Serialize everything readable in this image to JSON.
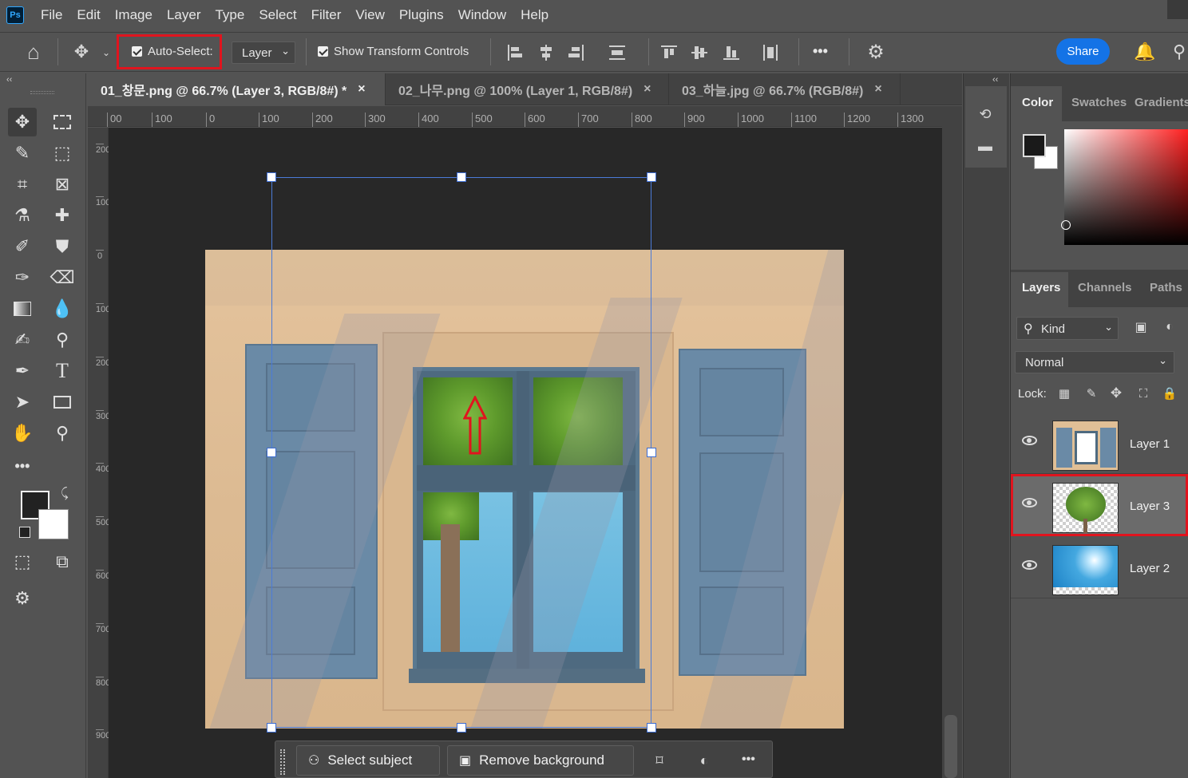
{
  "app": {
    "logo": "Ps"
  },
  "menu": [
    "File",
    "Edit",
    "Image",
    "Layer",
    "Type",
    "Select",
    "Filter",
    "View",
    "Plugins",
    "Window",
    "Help"
  ],
  "options": {
    "auto_select_label": "Auto-Select:",
    "auto_select_checked": true,
    "target_value": "Layer",
    "show_transform_label": "Show Transform Controls",
    "show_transform_checked": true,
    "more": "•••",
    "share_label": "Share"
  },
  "tabs": [
    {
      "label": "01_창문.png @ 66.7% (Layer 3, RGB/8#) *",
      "active": true
    },
    {
      "label": "02_나무.png @ 100% (Layer 1, RGB/8#)",
      "active": false
    },
    {
      "label": "03_하늘.jpg @ 66.7% (RGB/8#)",
      "active": false
    }
  ],
  "tab_close": "×",
  "ruler_top": [
    "00",
    "100",
    "0",
    "100",
    "200",
    "300",
    "400",
    "500",
    "600",
    "700",
    "800",
    "900",
    "1000",
    "1100",
    "1200",
    "1300"
  ],
  "ruler_left": [
    "200",
    "100",
    "0",
    "100",
    "200",
    "300",
    "400",
    "500",
    "600",
    "700",
    "800",
    "900"
  ],
  "context_bar": {
    "select_subject": "Select subject",
    "remove_background": "Remove background",
    "more": "•••"
  },
  "panels": {
    "color_tabs": [
      "Color",
      "Swatches",
      "Gradients"
    ],
    "layer_tabs": [
      "Layers",
      "Channels",
      "Paths"
    ],
    "kind_label": "Kind",
    "blend_mode": "Normal",
    "lock_label": "Lock:",
    "layers": [
      {
        "name": "Layer 1",
        "selected": false,
        "visible": true,
        "thumb": "window"
      },
      {
        "name": "Layer 3",
        "selected": true,
        "visible": true,
        "thumb": "tree"
      },
      {
        "name": "Layer 2",
        "selected": false,
        "visible": true,
        "thumb": "sky"
      }
    ]
  },
  "colors": {
    "accent": "#1473e6",
    "highlight_box": "#e0141e",
    "transform_box": "#4b7bd8"
  }
}
